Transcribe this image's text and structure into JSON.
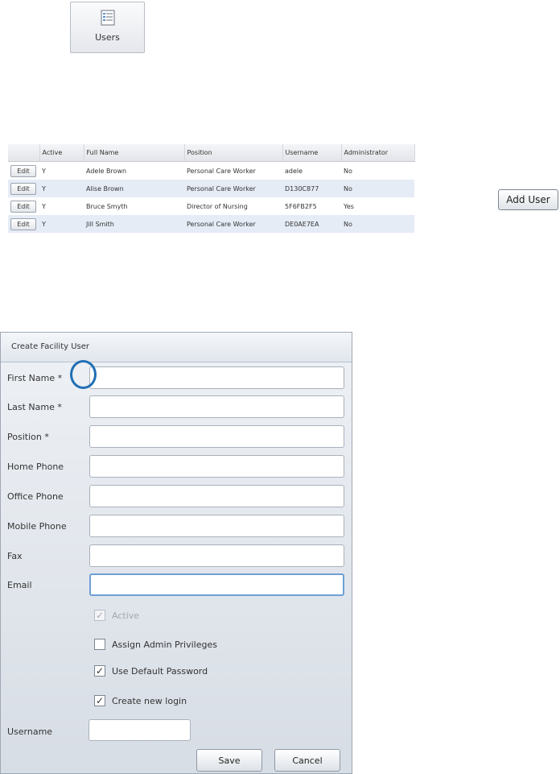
{
  "toolbar": {
    "users_label": "Users",
    "users_icon": "user-list-icon"
  },
  "users_table": {
    "columns": [
      "",
      "Active",
      "Full Name",
      "Position",
      "Username",
      "Administrator"
    ],
    "edit_label": "Edit",
    "rows": [
      {
        "active": "Y",
        "full_name": "Adele Brown",
        "position": "Personal Care Worker",
        "username": "adele",
        "administrator": "No"
      },
      {
        "active": "Y",
        "full_name": "Alise Brown",
        "position": "Personal Care Worker",
        "username": "D130C877",
        "administrator": "No"
      },
      {
        "active": "Y",
        "full_name": "Bruce Smyth",
        "position": "Director of Nursing",
        "username": "5F6FB2F5",
        "administrator": "Yes"
      },
      {
        "active": "Y",
        "full_name": "Jill Smith",
        "position": "Personal Care Worker",
        "username": "DE0AE7EA",
        "administrator": "No"
      }
    ]
  },
  "add_user_label": "Add User",
  "dialog": {
    "title": "Create Facility User",
    "fields": {
      "first_name": "First Name *",
      "last_name": "Last Name *",
      "position": "Position *",
      "home_phone": "Home Phone",
      "office_phone": "Office Phone",
      "mobile_phone": "Mobile Phone",
      "fax": "Fax",
      "email": "Email"
    },
    "checkboxes": {
      "active": {
        "label": "Active",
        "checked": true,
        "disabled": true
      },
      "assign_admin": {
        "label": "Assign Admin Privileges",
        "checked": false
      },
      "use_default_password": {
        "label": "Use Default Password",
        "checked": true
      },
      "create_new_login": {
        "label": "Create new login",
        "checked": true
      }
    },
    "checkmark": "✓",
    "username_label": "Username",
    "save_label": "Save",
    "cancel_label": "Cancel"
  },
  "colors": {
    "highlight_circle": "#1f6fb4",
    "alt_row": "#e6ecf6"
  }
}
